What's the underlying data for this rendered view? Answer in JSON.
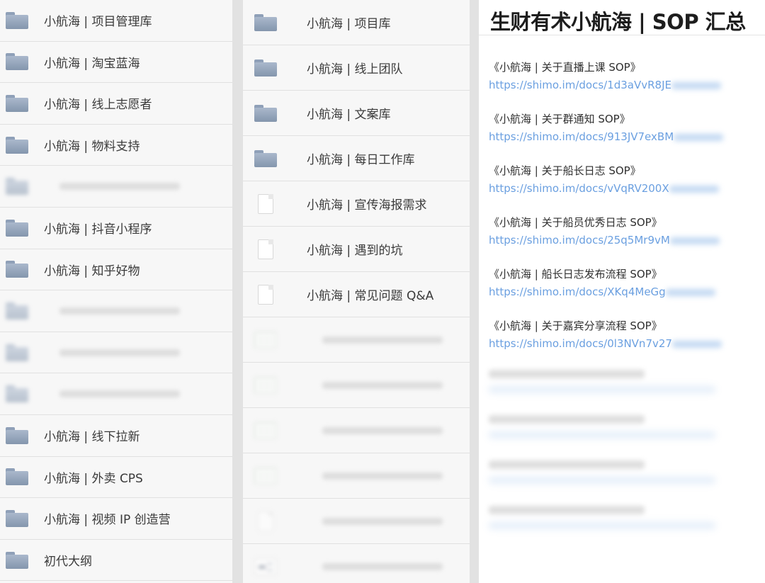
{
  "col1": {
    "items": [
      {
        "label": "小航海 | 项目管理库",
        "icon": "folder-icon"
      },
      {
        "label": "小航海 | 淘宝蓝海",
        "icon": "folder-icon"
      },
      {
        "label": "小航海 | 线上志愿者",
        "icon": "folder-icon"
      },
      {
        "label": "小航海 | 物料支持",
        "icon": "folder-icon"
      },
      {
        "label": "",
        "icon": "folder-icon",
        "blurred": true
      },
      {
        "label": "小航海 | 抖音小程序",
        "icon": "folder-icon"
      },
      {
        "label": "小航海 | 知乎好物",
        "icon": "folder-icon"
      },
      {
        "label": "",
        "icon": "folder-icon",
        "blurred": true
      },
      {
        "label": "",
        "icon": "folder-icon",
        "blurred": true
      },
      {
        "label": "",
        "icon": "folder-icon",
        "blurred": true
      },
      {
        "label": "小航海 | 线下拉新",
        "icon": "folder-icon"
      },
      {
        "label": "小航海 | 外卖 CPS",
        "icon": "folder-icon"
      },
      {
        "label": "小航海 | 视频 IP 创造营",
        "icon": "folder-icon"
      },
      {
        "label": "初代大纲",
        "icon": "folder-icon"
      }
    ]
  },
  "col2": {
    "items": [
      {
        "label": "小航海 | 项目库",
        "icon": "folder-icon"
      },
      {
        "label": "小航海 | 线上团队",
        "icon": "folder-icon"
      },
      {
        "label": "小航海 | 文案库",
        "icon": "folder-icon"
      },
      {
        "label": "小航海 | 每日工作库",
        "icon": "folder-icon"
      },
      {
        "label": "小航海 | 宣传海报需求",
        "icon": "document-icon"
      },
      {
        "label": "小航海 | 遇到的坑",
        "icon": "document-icon"
      },
      {
        "label": "小航海 | 常见问题 Q&A",
        "icon": "document-icon"
      },
      {
        "label": "",
        "icon": "spreadsheet-icon",
        "blurred": true
      },
      {
        "label": "",
        "icon": "spreadsheet-icon",
        "blurred": true
      },
      {
        "label": "",
        "icon": "spreadsheet-icon",
        "blurred": true
      },
      {
        "label": "",
        "icon": "spreadsheet-icon",
        "blurred": true
      },
      {
        "label": "",
        "icon": "document-icon",
        "blurred": true
      },
      {
        "label": "",
        "icon": "board-icon",
        "blurred": true
      }
    ]
  },
  "col3": {
    "title": "生财有术小航海 | SOP 汇总",
    "sops": [
      {
        "name": "《小航海 | 关于直播上课 SOP》",
        "link": "https://shimo.im/docs/1d3aVvR8JE"
      },
      {
        "name": "《小航海 | 关于群通知 SOP》",
        "link": "https://shimo.im/docs/913JV7exBM"
      },
      {
        "name": "《小航海 | 关于船长日志 SOP》",
        "link": "https://shimo.im/docs/vVqRV200X"
      },
      {
        "name": "《小航海 | 关于船员优秀日志 SOP》",
        "link": "https://shimo.im/docs/25q5Mr9vM"
      },
      {
        "name": "《小航海 | 船长日志发布流程 SOP》",
        "link": "https://shimo.im/docs/XKq4MeGg"
      },
      {
        "name": "《小航海 | 关于嘉宾分享流程 SOP》",
        "link": "https://shimo.im/docs/0l3NVn7v27"
      },
      {
        "name": "",
        "link": "",
        "blurred": true
      },
      {
        "name": "",
        "link": "",
        "blurred": true
      },
      {
        "name": "",
        "link": "",
        "blurred": true
      },
      {
        "name": "",
        "link": "",
        "blurred": true
      }
    ]
  }
}
